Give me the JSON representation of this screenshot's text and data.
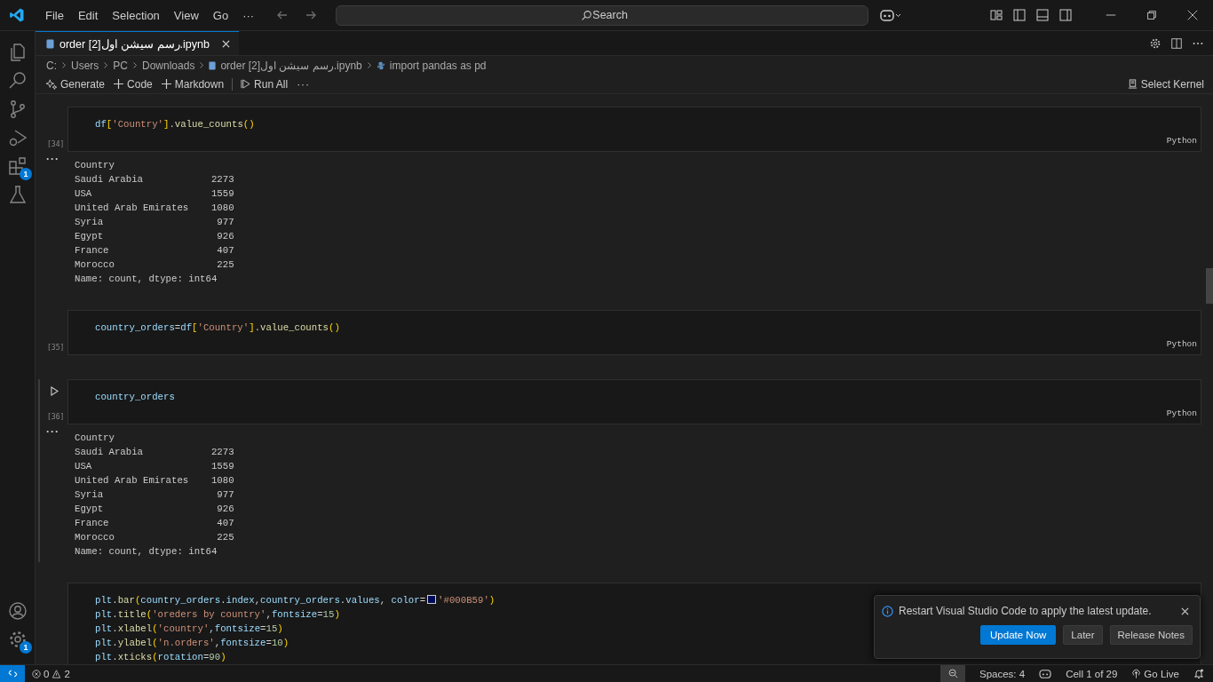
{
  "menu": [
    "File",
    "Edit",
    "Selection",
    "View",
    "Go",
    "···"
  ],
  "search": {
    "placeholder": "Search"
  },
  "activity_bar": [
    {
      "kind": "files"
    },
    {
      "kind": "search"
    },
    {
      "kind": "source-control"
    },
    {
      "kind": "run-debug"
    },
    {
      "kind": "extensions",
      "badge": "1"
    },
    {
      "kind": "flask"
    }
  ],
  "activity_bottom": [
    {
      "kind": "account"
    },
    {
      "kind": "gear",
      "badge": "1"
    }
  ],
  "tab": {
    "label": "order [2]رسم سيشن اول.ipynb"
  },
  "breadcrumbs": [
    {
      "kind": "text",
      "label": "C:"
    },
    {
      "kind": "text",
      "label": "Users"
    },
    {
      "kind": "text",
      "label": "PC"
    },
    {
      "kind": "text",
      "label": "Downloads"
    },
    {
      "kind": "notebook",
      "label": "order [2]رسم سيشن اول.ipynb"
    },
    {
      "kind": "python",
      "label": "import pandas as pd"
    }
  ],
  "toolbar": [
    {
      "kind": "sparkle",
      "label": "Generate"
    },
    {
      "kind": "plus",
      "label": "Code"
    },
    {
      "kind": "plus",
      "label": "Markdown"
    },
    {
      "kind": "run",
      "label": "Run All"
    },
    {
      "kind": "more",
      "label": "···"
    }
  ],
  "kernel": "Select Kernel",
  "cells": [
    {
      "count": "[34]",
      "lang": "Python",
      "focused": false,
      "lines": [
        [
          {
            "text": "df",
            "kind": "var"
          },
          {
            "text": "[",
            "kind": "b1"
          },
          {
            "text": "'Country'",
            "kind": "str"
          },
          {
            "text": "]",
            "kind": "b1"
          },
          {
            "text": ".",
            "kind": "p"
          },
          {
            "text": "value_counts",
            "kind": "fn"
          },
          {
            "text": "()",
            "kind": "b1"
          }
        ]
      ],
      "output": {
        "menu": "···",
        "lines": [
          "Country",
          "Saudi Arabia            2273",
          "USA                     1559",
          "United Arab Emirates    1080",
          "Syria                    977",
          "Egypt                    926",
          "France                   407",
          "Morocco                  225",
          "Name: count, dtype: int64"
        ]
      }
    },
    {
      "count": "[35]",
      "lang": "Python",
      "focused": false,
      "lines": [
        [
          {
            "text": "country_orders",
            "kind": "var"
          },
          {
            "text": "=",
            "kind": "p"
          },
          {
            "text": "df",
            "kind": "var"
          },
          {
            "text": "[",
            "kind": "b1"
          },
          {
            "text": "'Country'",
            "kind": "str"
          },
          {
            "text": "]",
            "kind": "b1"
          },
          {
            "text": ".",
            "kind": "p"
          },
          {
            "text": "value_counts",
            "kind": "fn"
          },
          {
            "text": "()",
            "kind": "b1"
          }
        ]
      ]
    },
    {
      "count": "[36]",
      "lang": "Python",
      "focused": true,
      "lines": [
        [
          {
            "text": "country_orders",
            "kind": "var"
          }
        ]
      ],
      "output": {
        "menu": "···",
        "lines": [
          "Country",
          "Saudi Arabia            2273",
          "USA                     1559",
          "United Arab Emirates    1080",
          "Syria                    977",
          "Egypt                    926",
          "France                   407",
          "Morocco                  225",
          "Name: count, dtype: int64"
        ]
      }
    },
    {
      "focused": false,
      "lines": [
        [
          {
            "text": "plt",
            "kind": "var"
          },
          {
            "text": ".",
            "kind": "p"
          },
          {
            "text": "bar",
            "kind": "fn"
          },
          {
            "text": "(",
            "kind": "b1"
          },
          {
            "text": "country_orders",
            "kind": "var"
          },
          {
            "text": ".",
            "kind": "p"
          },
          {
            "text": "index",
            "kind": "var"
          },
          {
            "text": ",",
            "kind": "p"
          },
          {
            "text": "country_orders",
            "kind": "var"
          },
          {
            "text": ".",
            "kind": "p"
          },
          {
            "text": "values",
            "kind": "var"
          },
          {
            "text": ", ",
            "kind": "p"
          },
          {
            "text": "color",
            "kind": "var"
          },
          {
            "text": "=",
            "kind": "p"
          },
          {
            "kind": "swatch",
            "color": "#000b59"
          },
          {
            "text": "'#000B59'",
            "kind": "str"
          },
          {
            "text": ")",
            "kind": "b1"
          }
        ],
        [
          {
            "text": "plt",
            "kind": "var"
          },
          {
            "text": ".",
            "kind": "p"
          },
          {
            "text": "title",
            "kind": "fn"
          },
          {
            "text": "(",
            "kind": "b1"
          },
          {
            "text": "'oreders by country'",
            "kind": "str"
          },
          {
            "text": ",",
            "kind": "p"
          },
          {
            "text": "fontsize",
            "kind": "var"
          },
          {
            "text": "=",
            "kind": "p"
          },
          {
            "text": "15",
            "kind": "num"
          },
          {
            "text": ")",
            "kind": "b1"
          }
        ],
        [
          {
            "text": "plt",
            "kind": "var"
          },
          {
            "text": ".",
            "kind": "p"
          },
          {
            "text": "xlabel",
            "kind": "fn"
          },
          {
            "text": "(",
            "kind": "b1"
          },
          {
            "text": "'country'",
            "kind": "str"
          },
          {
            "text": ",",
            "kind": "p"
          },
          {
            "text": "fontsize",
            "kind": "var"
          },
          {
            "text": "=",
            "kind": "p"
          },
          {
            "text": "15",
            "kind": "num"
          },
          {
            "text": ")",
            "kind": "b1"
          }
        ],
        [
          {
            "text": "plt",
            "kind": "var"
          },
          {
            "text": ".",
            "kind": "p"
          },
          {
            "text": "ylabel",
            "kind": "fn"
          },
          {
            "text": "(",
            "kind": "b1"
          },
          {
            "text": "'n.orders'",
            "kind": "str"
          },
          {
            "text": ",",
            "kind": "p"
          },
          {
            "text": "fontsize",
            "kind": "var"
          },
          {
            "text": "=",
            "kind": "p"
          },
          {
            "text": "10",
            "kind": "num"
          },
          {
            "text": ")",
            "kind": "b1"
          }
        ],
        [
          {
            "text": "plt",
            "kind": "var"
          },
          {
            "text": ".",
            "kind": "p"
          },
          {
            "text": "xticks",
            "kind": "fn"
          },
          {
            "text": "(",
            "kind": "b1"
          },
          {
            "text": "rotation",
            "kind": "var"
          },
          {
            "text": "=",
            "kind": "p"
          },
          {
            "text": "90",
            "kind": "num"
          },
          {
            "text": ")",
            "kind": "b1"
          }
        ]
      ]
    }
  ],
  "notification": {
    "message": "Restart Visual Studio Code to apply the latest update.",
    "buttons": [
      {
        "label": "Update Now",
        "primary": true
      },
      {
        "label": "Later",
        "primary": false
      },
      {
        "label": "Release Notes",
        "primary": false
      }
    ]
  },
  "status_bar": {
    "errors": "0",
    "warnings": "2",
    "spaces": "Spaces: 4",
    "cell": "Cell 1 of 29",
    "go_live": "Go Live"
  }
}
